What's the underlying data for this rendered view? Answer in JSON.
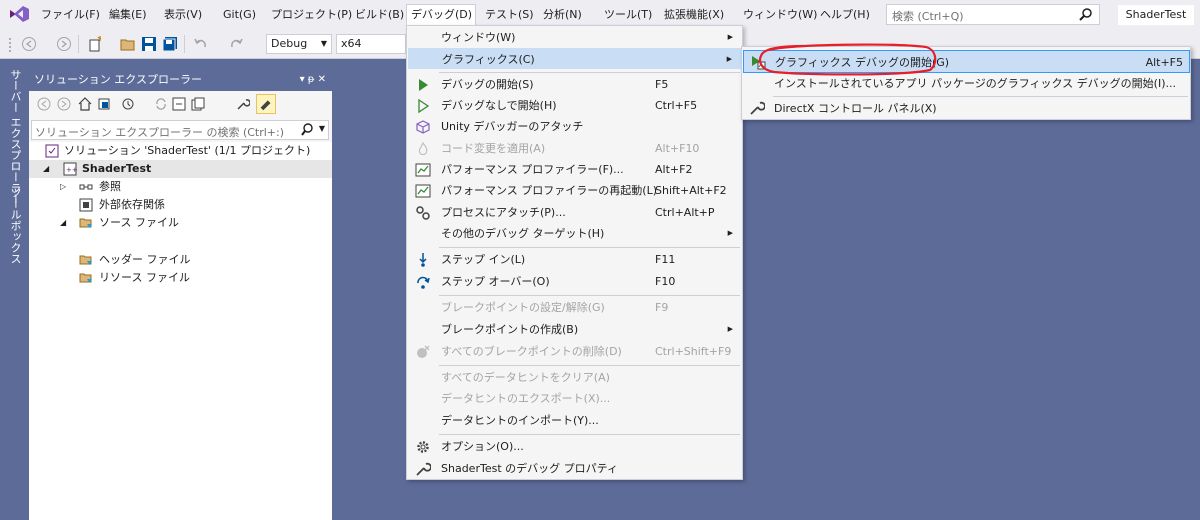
{
  "menubar": {
    "items": [
      "ファイル(F)",
      "編集(E)",
      "表示(V)",
      "Git(G)",
      "プロジェクト(P)",
      "ビルド(B)",
      "デバッグ(D)",
      "テスト(S)",
      "分析(N)",
      "ツール(T)",
      "拡張機能(X)",
      "ウィンドウ(W)",
      "ヘルプ(H)"
    ],
    "search_placeholder": "検索 (Ctrl+Q)",
    "solution_name": "ShaderTest"
  },
  "toolbar": {
    "config": "Debug",
    "platform": "x64"
  },
  "side_tabs": [
    "サーバー エクスプローラー",
    "ツールボックス"
  ],
  "solution_explorer": {
    "title": "ソリューション エクスプローラー",
    "title_icons": "▾ ᵽ ✕",
    "search_placeholder": "ソリューション エクスプローラー の検索 (Ctrl+:)",
    "tree": {
      "solution": "ソリューション 'ShaderTest' (1/1 プロジェクト)",
      "project": "ShaderTest",
      "references": "参照",
      "external_deps": "外部依存関係",
      "source_files": "ソース ファイル",
      "header_files": "ヘッダー ファイル",
      "resource_files": "リソース ファイル"
    }
  },
  "debug_menu": {
    "items": [
      {
        "label": "ウィンドウ(W)",
        "shortcut": "",
        "submenu": "▶"
      },
      {
        "label": "グラフィックス(C)",
        "shortcut": "",
        "submenu": "▶"
      },
      {
        "label": "デバッグの開始(S)",
        "shortcut": "F5"
      },
      {
        "label": "デバッグなしで開始(H)",
        "shortcut": "Ctrl+F5"
      },
      {
        "label": "Unity デバッガーのアタッチ",
        "shortcut": ""
      },
      {
        "label": "コード変更を適用(A)",
        "shortcut": "Alt+F10"
      },
      {
        "label": "パフォーマンス プロファイラー(F)...",
        "shortcut": "Alt+F2"
      },
      {
        "label": "パフォーマンス プロファイラーの再起動(L)",
        "shortcut": "Shift+Alt+F2"
      },
      {
        "label": "プロセスにアタッチ(P)...",
        "shortcut": "Ctrl+Alt+P"
      },
      {
        "label": "その他のデバッグ ターゲット(H)",
        "shortcut": "",
        "submenu": "▶"
      },
      {
        "label": "ステップ イン(L)",
        "shortcut": "F11"
      },
      {
        "label": "ステップ オーバー(O)",
        "shortcut": "F10"
      },
      {
        "label": "ブレークポイントの設定/解除(G)",
        "shortcut": "F9"
      },
      {
        "label": "ブレークポイントの作成(B)",
        "shortcut": "",
        "submenu": "▶"
      },
      {
        "label": "すべてのブレークポイントの削除(D)",
        "shortcut": "Ctrl+Shift+F9"
      },
      {
        "label": "すべてのデータヒントをクリア(A)",
        "shortcut": ""
      },
      {
        "label": "データヒントのエクスポート(X)...",
        "shortcut": ""
      },
      {
        "label": "データヒントのインポート(Y)...",
        "shortcut": ""
      },
      {
        "label": "オプション(O)...",
        "shortcut": ""
      },
      {
        "label": "ShaderTest のデバッグ プロパティ",
        "shortcut": ""
      }
    ]
  },
  "graphics_submenu": {
    "items": [
      {
        "label": "グラフィックス デバッグの開始(G)",
        "shortcut": "Alt+F5"
      },
      {
        "label": "インストールされているアプリ パッケージのグラフィックス デバッグの開始(I)...",
        "shortcut": ""
      },
      {
        "label": "DirectX コントロール パネル(X)",
        "shortcut": ""
      }
    ]
  },
  "colors": {
    "chrome": "#eeeef2",
    "frame": "#5d6b99",
    "highlight": "#c9def5",
    "annotation": "#e5202a"
  }
}
